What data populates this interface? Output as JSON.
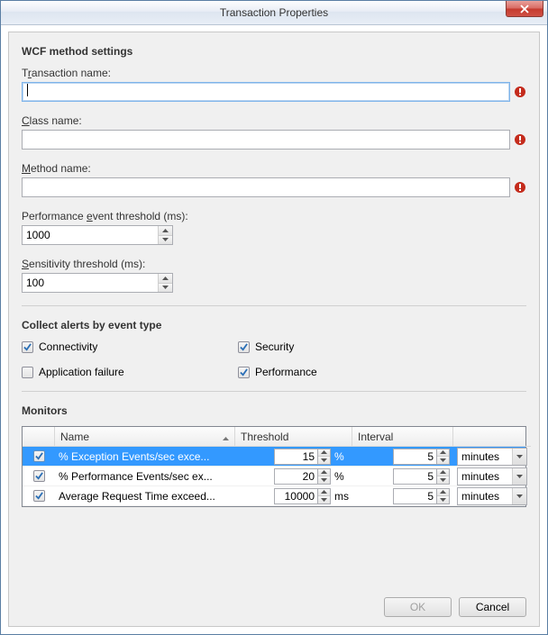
{
  "window": {
    "title": "Transaction Properties"
  },
  "section1": {
    "heading": "WCF method settings",
    "transaction_label_pre": "T",
    "transaction_label_u": "r",
    "transaction_label_post": "ansaction name:",
    "transaction_value": "",
    "class_label_u": "C",
    "class_label_post": "lass name:",
    "class_value": "",
    "method_label_u": "M",
    "method_label_post": "ethod name:",
    "method_value": "",
    "pet_label_pre": "Performance ",
    "pet_label_u": "e",
    "pet_label_post": "vent threshold (ms):",
    "pet_value": "1000",
    "sens_label_pre": "",
    "sens_label_u": "S",
    "sens_label_post": "ensitivity threshold (ms):",
    "sens_value": "100"
  },
  "section2": {
    "heading": "Collect alerts by event type",
    "items": [
      {
        "label": "Connectivity",
        "checked": true
      },
      {
        "label": "Security",
        "checked": true
      },
      {
        "label": "Application failure",
        "checked": false
      },
      {
        "label": "Performance",
        "checked": true
      }
    ]
  },
  "section3": {
    "heading": "Monitors",
    "columns": {
      "c0": "",
      "c1": "Name",
      "c2": "Threshold",
      "c3": "Interval",
      "c4": ""
    },
    "rows": [
      {
        "checked": true,
        "name": "% Exception Events/sec exce...",
        "threshold": "15",
        "unit": "%",
        "interval": "5",
        "interval_unit": "minutes",
        "selected": true
      },
      {
        "checked": true,
        "name": "% Performance Events/sec ex...",
        "threshold": "20",
        "unit": "%",
        "interval": "5",
        "interval_unit": "minutes",
        "selected": false
      },
      {
        "checked": true,
        "name": "Average Request Time exceed...",
        "threshold": "10000",
        "unit": "ms",
        "interval": "5",
        "interval_unit": "minutes",
        "selected": false
      }
    ]
  },
  "buttons": {
    "ok": "OK",
    "cancel": "Cancel"
  }
}
